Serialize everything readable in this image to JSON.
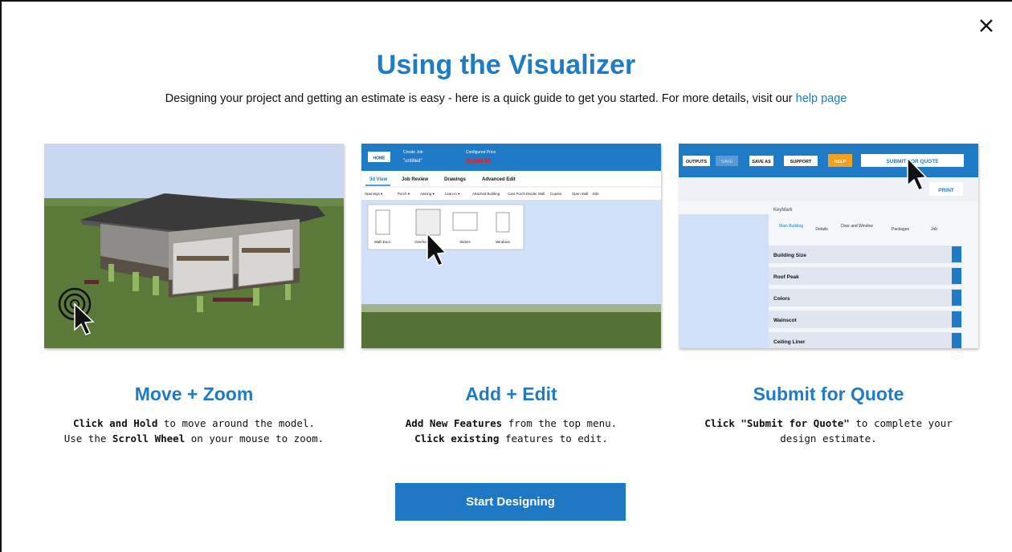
{
  "modal": {
    "title": "Using the Visualizer",
    "subtitle_text": "Designing your project and getting an estimate is easy - here is a quick guide to get you started. For more details, visit our ",
    "help_link": "help page",
    "close_icon": "close-icon"
  },
  "steps": [
    {
      "heading": "Move + Zoom",
      "line1_bold": "Click and Hold",
      "line1_rest": " to move around the model.",
      "line2_pre": "Use the ",
      "line2_bold": "Scroll Wheel",
      "line2_rest": " on your mouse to zoom."
    },
    {
      "heading": "Add + Edit",
      "line1_bold": "Add New Features",
      "line1_rest": " from the top menu.",
      "line2_pre": "",
      "line2_bold": "Click existing",
      "line2_rest": " features to edit."
    },
    {
      "heading": "Submit for Quote",
      "line1_bold": "Click \"Submit for Quote\"",
      "line1_rest": " to complete your",
      "line2_pre": "design estimate.",
      "line2_bold": "",
      "line2_rest": ""
    }
  ],
  "screen2": {
    "home": "HOME",
    "create_job": "Create Job",
    "job_name": "\"untitled\"",
    "configured_price": "Configured Price",
    "price": "$0,000.00",
    "tabs": [
      "3d View",
      "Job Review",
      "Drawings",
      "Advanced Edit"
    ],
    "menu": [
      "Openings ▾",
      "Porch ▾",
      "Awning ▾",
      "Lean-to ▾",
      "Attached Building",
      "Cant Porch",
      "Divider Wall",
      "Cupola",
      "Open Wall",
      "Edit"
    ],
    "options": [
      "Walk Door",
      "Overhead",
      "Sliders",
      "Windows"
    ]
  },
  "screen3": {
    "toolbar": [
      "OUTPUTS",
      "SAVE",
      "SAVE AS",
      "SUPPORT",
      "HELP"
    ],
    "submit": "SUBMIT FOR QUOTE",
    "print": "PRINT",
    "brand": "KeyMark",
    "tabs": [
      "Main Building",
      "Details",
      "Door and Window",
      "Packages",
      "Job"
    ],
    "rows": [
      "Building Size",
      "Roof Peak",
      "Colors",
      "Wainscot",
      "Ceiling Liner"
    ]
  },
  "cta": {
    "label": "Start Designing"
  },
  "colors": {
    "accent": "#1f7bc6",
    "button": "#1f78c4",
    "help_orange": "#f5a020"
  }
}
